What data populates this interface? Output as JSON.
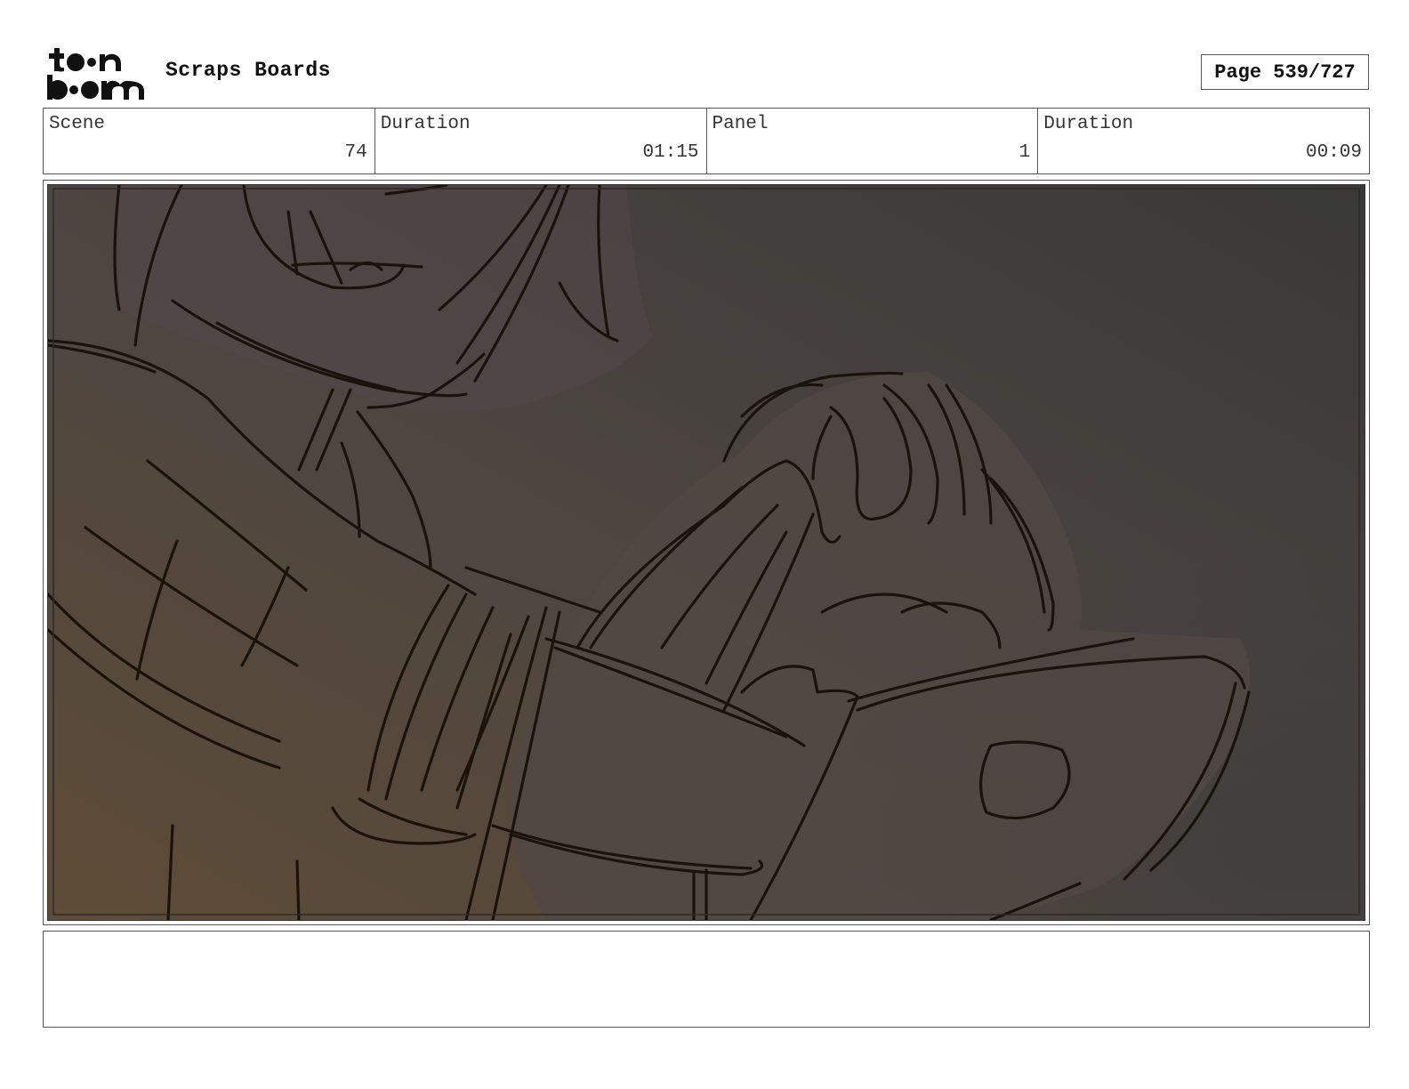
{
  "header": {
    "logo_text": "toonboom",
    "project_title": "Scraps Boards",
    "page_indicator": "Page 539/727"
  },
  "info": {
    "scene_label": "Scene",
    "scene_value": "74",
    "scene_duration_label": "Duration",
    "scene_duration_value": "01:15",
    "panel_label": "Panel",
    "panel_value": "1",
    "panel_duration_label": "Duration",
    "panel_duration_value": "00:09"
  },
  "notes": {
    "text": ""
  },
  "colors": {
    "sketch_line": "#1a130c",
    "bg_dark": "#3a3a3a",
    "bg_warm": "#5e4c36"
  }
}
